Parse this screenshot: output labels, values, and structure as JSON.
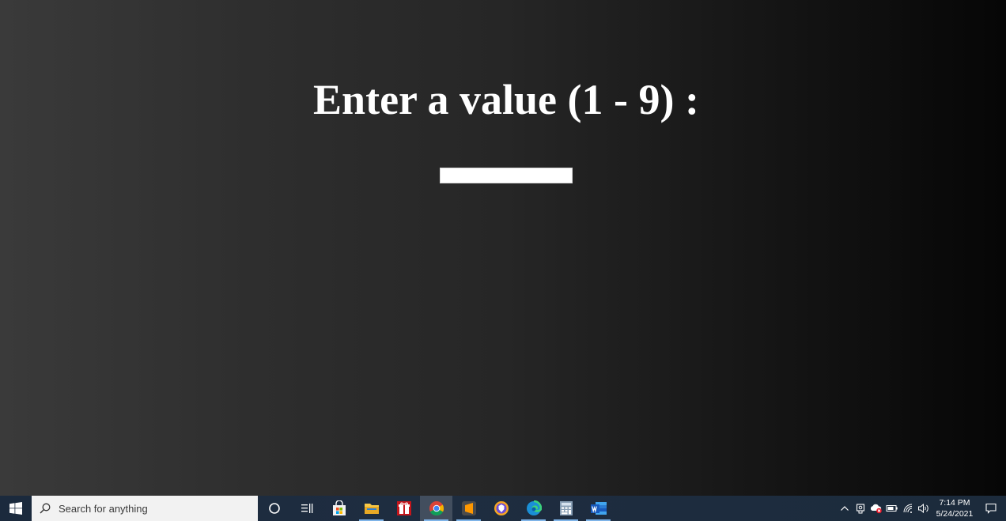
{
  "app": {
    "prompt": "Enter a value (1 - 9) :",
    "input": {
      "value": "",
      "placeholder": ""
    }
  },
  "taskbar": {
    "search_placeholder": "Search for anything",
    "pinned_apps": [
      "cortana-icon",
      "task-view-icon",
      "store-icon",
      "file-explorer-icon",
      "gift-app-icon",
      "chrome-icon",
      "sublime-text-icon",
      "brave-icon",
      "edge-icon",
      "calculator-icon",
      "word-icon"
    ],
    "clock": {
      "time": "7:14 PM",
      "date": "5/24/2021"
    }
  }
}
